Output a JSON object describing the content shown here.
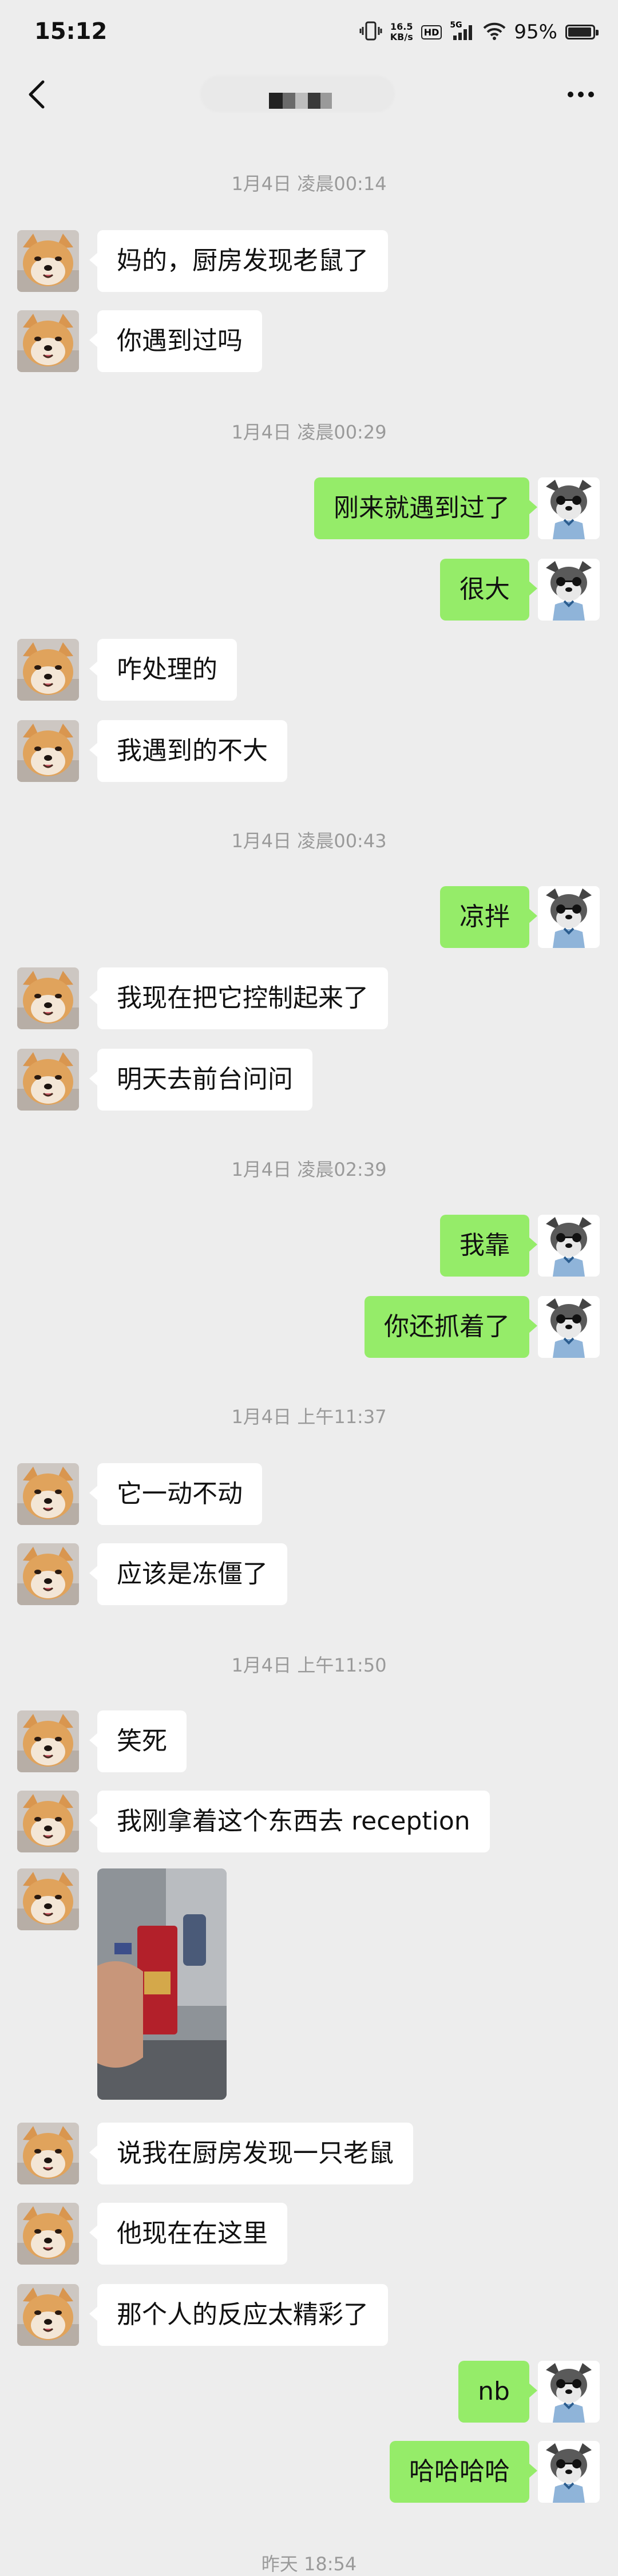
{
  "status_bar": {
    "time": "15:12",
    "net_speed_value": "16.5",
    "net_speed_unit": "KB/s",
    "hd_badge": "HD",
    "signal_label": "5G",
    "battery_text": "95%",
    "battery_level": 0.95
  },
  "nav": {
    "back_icon": "chevron-left-icon",
    "more_icon": "more-dots-icon"
  },
  "timestamps": [
    "1月4日 凌晨00:14",
    "1月4日 凌晨00:29",
    "1月4日 凌晨00:43",
    "1月4日 凌晨02:39",
    "1月4日 上午11:37",
    "1月4日 上午11:50",
    "昨天 18:54"
  ],
  "messages": [
    {
      "side": "left",
      "text": "妈的，厨房发现老鼠了"
    },
    {
      "side": "left",
      "text": "你遇到过吗"
    },
    {
      "side": "right",
      "text": "刚来就遇到过了"
    },
    {
      "side": "right",
      "text": "很大"
    },
    {
      "side": "left",
      "text": "咋处理的"
    },
    {
      "side": "left",
      "text": "我遇到的不大"
    },
    {
      "side": "right",
      "text": "凉拌"
    },
    {
      "side": "left",
      "text": "我现在把它控制起来了"
    },
    {
      "side": "left",
      "text": "明天去前台问问"
    },
    {
      "side": "right",
      "text": "我靠"
    },
    {
      "side": "right",
      "text": "你还抓着了"
    },
    {
      "side": "left",
      "text": "它一动不动"
    },
    {
      "side": "left",
      "text": "应该是冻僵了"
    },
    {
      "side": "left",
      "text": "笑死"
    },
    {
      "side": "left",
      "text": "我刚拿着这个东西去 reception"
    },
    {
      "side": "left",
      "text": "说我在厨房发现一只老鼠"
    },
    {
      "side": "left",
      "text": "他现在在这里"
    },
    {
      "side": "left",
      "text": "那个人的反应太精彩了"
    },
    {
      "side": "right",
      "text": "nb"
    },
    {
      "side": "right",
      "text": "哈哈哈哈"
    }
  ],
  "colors": {
    "background": "#ededed",
    "incoming_bubble": "#ffffff",
    "outgoing_bubble": "#95ec69",
    "timestamp": "#9a9a9a"
  }
}
